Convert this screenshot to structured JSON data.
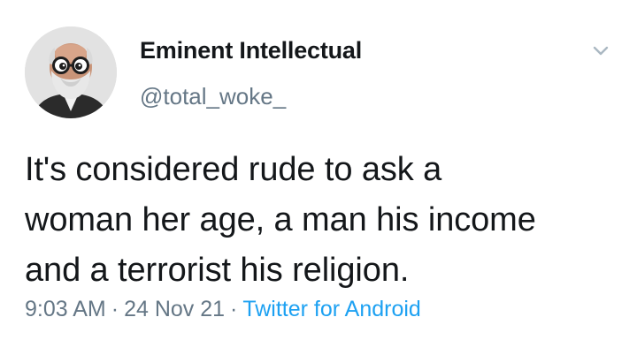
{
  "user": {
    "display_name": "Eminent Intellectual",
    "handle": "@total_woke_"
  },
  "tweet": {
    "lines": [
      "It's considered rude to ask a",
      "woman her age, a man his income",
      "and a terrorist his religion."
    ]
  },
  "meta": {
    "time": "9:03 AM",
    "separator": "·",
    "date": "24 Nov 21",
    "source": "Twitter for Android"
  },
  "icons": {
    "avatar": "profile-photo",
    "menu": "chevron-down-icon"
  },
  "colors": {
    "text": "#14171a",
    "secondary": "#657786",
    "link": "#1da1f2",
    "background": "#ffffff"
  }
}
